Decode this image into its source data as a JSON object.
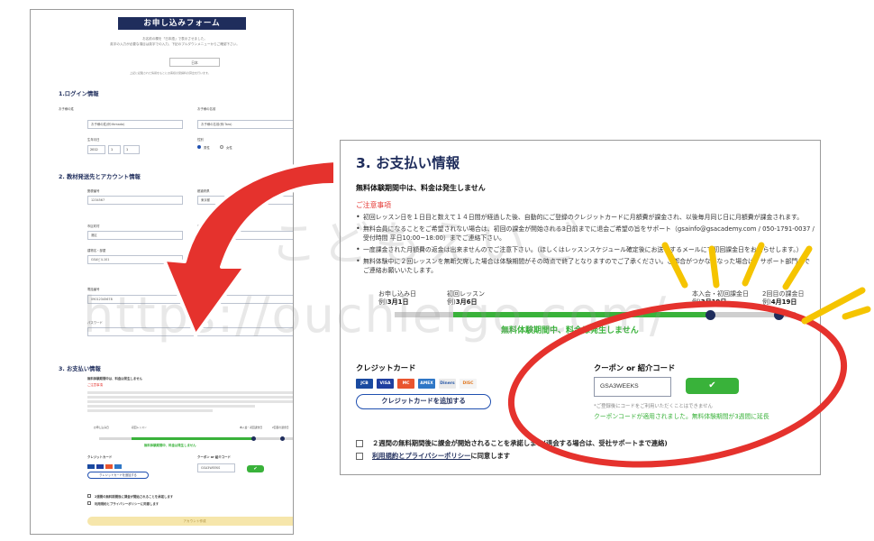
{
  "thumbnail": {
    "banner": "お申し込みフォーム",
    "intro_lines": [
      "お名前の欄を「日本語」で表示させました。",
      "英字の入力が必要な項目は英字での入力、下記のプルダウンメニューからご確認下さい。"
    ],
    "language_select": "日本",
    "intro_note": "上記に記載された情報をもとにお客様の受講料の算出を行います。",
    "section1": "1.ログイン情報",
    "family_name_label": "お子様の姓",
    "given_name_label": "お子様の名前",
    "family_name_value": "お子様の姓(例:Yamada)",
    "given_name_value": "お子様の名前(例:Taro)",
    "birthday_label": "生年月日",
    "birthday_year": "2012",
    "birthday_month": "1",
    "birthday_day": "1",
    "gender_label": "性別",
    "gender_male": "男性",
    "gender_female": "女性",
    "section2": "2. 教材発送先とアカウント情報",
    "postal_label": "郵便番号",
    "prefecture_label": "都道府県",
    "postal_value": "1234567",
    "prefecture_value": "東京都",
    "city_label": "市区町村",
    "address_label": "番地・建物",
    "city_value": "港区",
    "address_value": "1丁目2-3",
    "building_label": "建物名・部屋",
    "building_value": "GSAビル101",
    "phone_label": "電話番号",
    "phone_value": "09012345678",
    "password_label": "パスワード",
    "section3": "3. お支払い情報",
    "free_period": "無料体験期間中は、料金は発生しません",
    "notes_header": "ご注意事項",
    "tl_start": "お申し込み日",
    "tl_first": "初回レッスン",
    "tl_join": "本入会・初回課金日",
    "tl_second": "2回目の課金日",
    "tl_free": "無料体験期間中、料金は発生しません",
    "cc_header": "クレジットカード",
    "add_card": "クレジットカードを追加する",
    "coupon_header": "クーポン or 紹介コード",
    "coupon_value": "GSA3WEEKS",
    "agree1": "2週間の無料期間後に課金が開始されることを承諾します",
    "agree2": "利用規約とプライバシーポリシーに同意します",
    "submit": "アカウント作成"
  },
  "zoom": {
    "title": "3. お支払い情報",
    "free_notice": "無料体験期間中は、料金は発生しません",
    "notes_header": "ご注意事項",
    "notes": [
      "初回レッスン日を１日目と数えて１４日間が経過した後、自動的にご登録のクレジットカードに月額費が課金され、以後毎月同じ日に月額費が課金されます。",
      "無料会員になることをご希望されない場合は、初回の課金が開始される3日前までに退会ご希望の旨をサポート（gsainfo@gsacademy.com / 050-1791-0037 / 受付時間 平日10:00~18:00）までご連絡下さい。",
      "一度課金された月額費の返金は出来ませんのでご注意下さい。（ほしくはレッスンスケジュール確定後にお送りするメールにて初回課金日をお知らせします。）",
      "無料体験中に２回レッスンを無断欠席した場合は体験期間がその時点で終了となりますのでご了承ください。ご都合がつかなくなった場合は、サポート部門までご連絡お願いいたします。"
    ],
    "timeline": {
      "start_label": "お申し込み日",
      "start_date_prefix": "例)",
      "start_date": "3月1日",
      "first_label": "初回レッスン",
      "first_date_prefix": "例)",
      "first_date": "3月6日",
      "join_label": "本入会・初回課金日",
      "join_date_prefix": "例)",
      "join_date": "3月19日",
      "second_label": "2回目の課金日",
      "second_date_prefix": "例)",
      "second_date": "4月19日",
      "free_text": "無料体験期間中、料金は発生しません"
    },
    "credit_card_header": "クレジットカード",
    "card_brands": [
      "JCB",
      "VISA",
      "MC",
      "AMEX",
      "Diners",
      "DISC"
    ],
    "add_card_button": "クレジットカードを追加する",
    "coupon_header": "クーポン or 紹介コード",
    "coupon_value": "GSA3WEEKS",
    "coupon_button": "✔",
    "coupon_note": "*ご登録後にコードをご利用いただくことはできません",
    "coupon_ok": "クーポンコードが適用されました。無料体験期間が3週間に延長",
    "agree1": "２週間の無料期間後に課金が開始されることを承諾します(退会する場合は、受社サポートまで連絡)",
    "agree2_link": "利用規約とプライバシーポリシー",
    "agree2_rest": "に同意します"
  },
  "watermark": {
    "jp": "こどもえいご",
    "url": "https://ouchieigo.com/"
  },
  "colors": {
    "navy": "#1f2d5c",
    "green": "#39b23a",
    "red_annotation": "#e5322d",
    "yellow_annotation": "#f5c400"
  }
}
